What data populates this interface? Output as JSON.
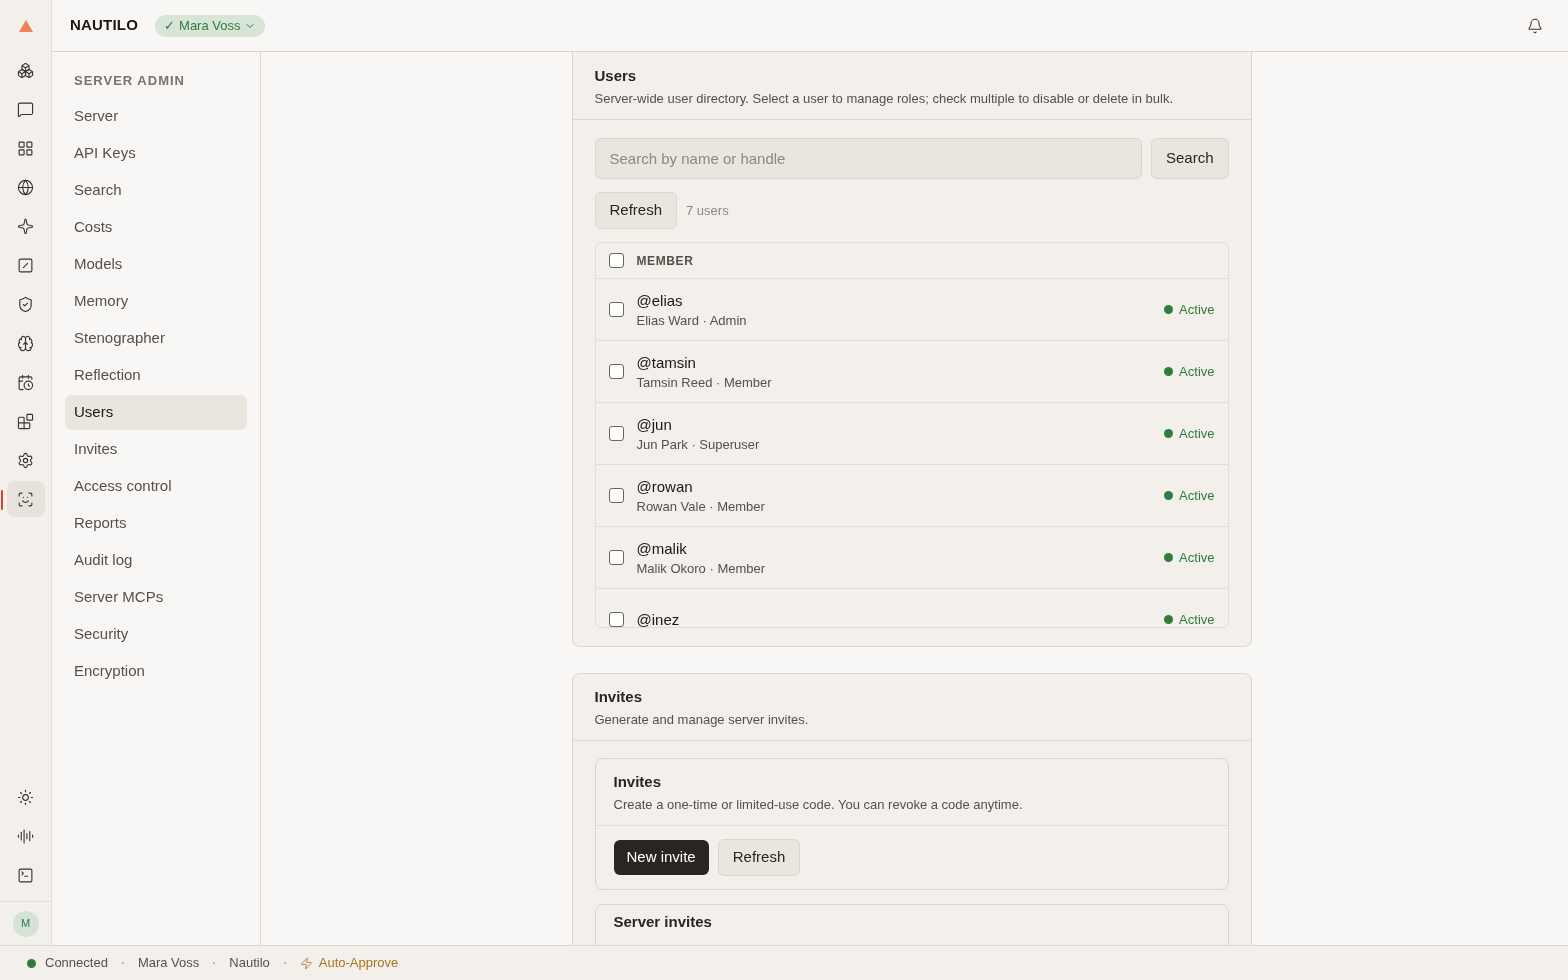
{
  "app": {
    "name": "NAUTILO",
    "user_badge": "Mara Voss",
    "user_badge_check": "✓"
  },
  "rail": [
    {
      "selected": false
    },
    {
      "selected": false
    },
    {
      "selected": false
    },
    {
      "selected": false
    },
    {
      "selected": false
    },
    {
      "selected": false
    },
    {
      "selected": false
    },
    {
      "selected": false
    },
    {
      "selected": false
    },
    {
      "selected": false
    },
    {
      "selected": false
    },
    {
      "selected": true
    }
  ],
  "rail_bottom": [
    {
      "selected": false
    },
    {
      "selected": false
    },
    {
      "selected": false
    }
  ],
  "avatar": "M",
  "sidebar": {
    "heading": "SERVER ADMIN",
    "items": [
      {
        "label": "Server",
        "selected": false
      },
      {
        "label": "API Keys",
        "selected": false
      },
      {
        "label": "Search",
        "selected": false
      },
      {
        "label": "Costs",
        "selected": false
      },
      {
        "label": "Models",
        "selected": false
      },
      {
        "label": "Memory",
        "selected": false
      },
      {
        "label": "Stenographer",
        "selected": false
      },
      {
        "label": "Reflection",
        "selected": false
      },
      {
        "label": "Users",
        "selected": true
      },
      {
        "label": "Invites",
        "selected": false
      },
      {
        "label": "Access control",
        "selected": false
      },
      {
        "label": "Reports",
        "selected": false
      },
      {
        "label": "Audit log",
        "selected": false
      },
      {
        "label": "Server MCPs",
        "selected": false
      },
      {
        "label": "Security",
        "selected": false
      },
      {
        "label": "Encryption",
        "selected": false
      }
    ]
  },
  "users": {
    "title": "Users",
    "description": "Server-wide user directory. Select a user to manage roles; check multiple to disable or delete in bulk.",
    "search": {
      "placeholder": "Search by name or handle",
      "button": "Search"
    },
    "refresh": "Refresh",
    "count": "7 users",
    "table": {
      "header": "MEMBER",
      "header_checked": false,
      "rows": [
        {
          "handle": "@elias",
          "detail": "Elias Ward · Admin",
          "status": "Active",
          "color": "#2e7d3e",
          "checked": false
        },
        {
          "handle": "@tamsin",
          "detail": "Tamsin Reed · Member",
          "status": "Active",
          "color": "#2e7d3e",
          "checked": false
        },
        {
          "handle": "@jun",
          "detail": "Jun Park · Superuser",
          "status": "Active",
          "color": "#2e7d3e",
          "checked": false
        },
        {
          "handle": "@rowan",
          "detail": "Rowan Vale · Member",
          "status": "Active",
          "color": "#2e7d3e",
          "checked": false
        },
        {
          "handle": "@malik",
          "detail": "Malik Okoro · Member",
          "status": "Active",
          "color": "#2e7d3e",
          "checked": false
        },
        {
          "handle": "@inez",
          "status": "Active",
          "color": "#2e7d3e",
          "checked": false
        }
      ]
    }
  },
  "invites": {
    "title": "Invites",
    "description": "Generate and manage server invites.",
    "inner": {
      "title": "Invites",
      "description": "Create a one-time or limited-use code. You can revoke a code anytime.",
      "primary": "New invite",
      "secondary": "Refresh"
    },
    "server_invites": {
      "title": "Server invites"
    }
  },
  "status_bar": [
    {
      "kind": "connection",
      "label": "Connected",
      "color": "#2e7d3e"
    },
    {
      "kind": "text",
      "label": "Mara Voss"
    },
    {
      "kind": "text",
      "label": "Nautilo"
    },
    {
      "kind": "mode",
      "label": "Auto-Approve"
    }
  ]
}
